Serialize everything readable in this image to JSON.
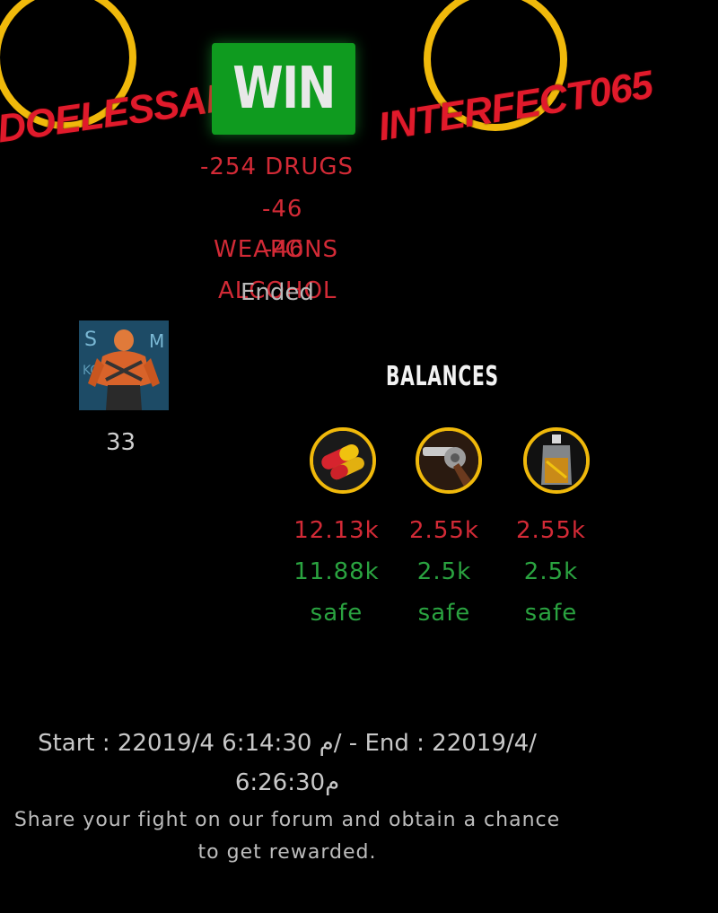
{
  "result": {
    "label": "WIN",
    "status": "Ended"
  },
  "players": {
    "left": {
      "name": "DOELESSALY"
    },
    "right": {
      "name": "INTERFECT065"
    }
  },
  "losses": {
    "drugs": "-254 DRUGS",
    "weapons_amount": "-46",
    "weapons_label": "WEAPONS",
    "alcohol_amount": "-46",
    "alcohol_label": "ALCOHOL"
  },
  "avatar": {
    "level": "33"
  },
  "balances": {
    "title": "BALANCES",
    "items": [
      {
        "icon": "pills-icon",
        "total": "12.13k",
        "safe_amount": "11.88k",
        "safe_label": "safe"
      },
      {
        "icon": "revolver-icon",
        "total": "2.55k",
        "safe_amount": "2.5k",
        "safe_label": "safe"
      },
      {
        "icon": "whiskey-bottle-icon",
        "total": "2.55k",
        "safe_amount": "2.5k",
        "safe_label": "safe"
      }
    ]
  },
  "footer": {
    "time_line1": "Start : 2م 6:14:30 2019/4/ - End : 22019/4/",
    "time_line2": "6:26:30م",
    "share_line1": "Share your fight on our forum and obtain a chance",
    "share_line2": "to get rewarded."
  },
  "colors": {
    "accent": "#f0b90b",
    "win": "#0f9b1f",
    "loss": "#d22a36",
    "gain": "#2aa340"
  }
}
